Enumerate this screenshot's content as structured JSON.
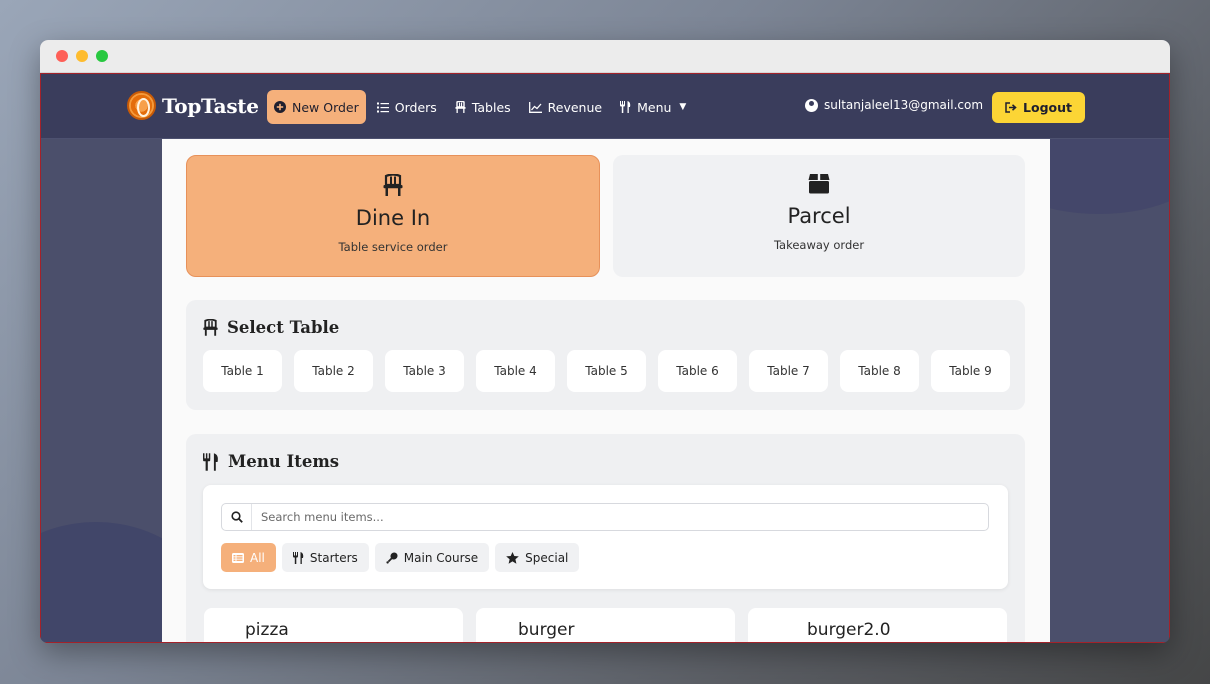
{
  "brand": {
    "name": "TopTaste"
  },
  "nav": {
    "new_order": "New Order",
    "orders": "Orders",
    "tables": "Tables",
    "revenue": "Revenue",
    "menu": "Menu"
  },
  "user": {
    "email": "sultanjaleel13@gmail.com"
  },
  "logout": "Logout",
  "order_types": [
    {
      "title": "Dine In",
      "subtitle": "Table service order",
      "selected": true,
      "icon": "chair-icon"
    },
    {
      "title": "Parcel",
      "subtitle": "Takeaway order",
      "selected": false,
      "icon": "box-icon"
    }
  ],
  "select_table": {
    "title": "Select Table",
    "tables": [
      "Table 1",
      "Table 2",
      "Table 3",
      "Table 4",
      "Table 5",
      "Table 6",
      "Table 7",
      "Table 8",
      "Table 9"
    ]
  },
  "menu_items": {
    "title": "Menu Items",
    "search_placeholder": "Search menu items...",
    "filters": [
      {
        "label": "All",
        "active": true,
        "icon": "list-icon"
      },
      {
        "label": "Starters",
        "active": false,
        "icon": "utensils-icon"
      },
      {
        "label": "Main Course",
        "active": false,
        "icon": "drumstick-icon"
      },
      {
        "label": "Special",
        "active": false,
        "icon": "star-icon"
      }
    ],
    "items": [
      "pizza",
      "burger",
      "burger2.0"
    ]
  },
  "colors": {
    "accent": "#f5b07b",
    "navbar": "#3a3d5c",
    "logout": "#fcd535"
  }
}
